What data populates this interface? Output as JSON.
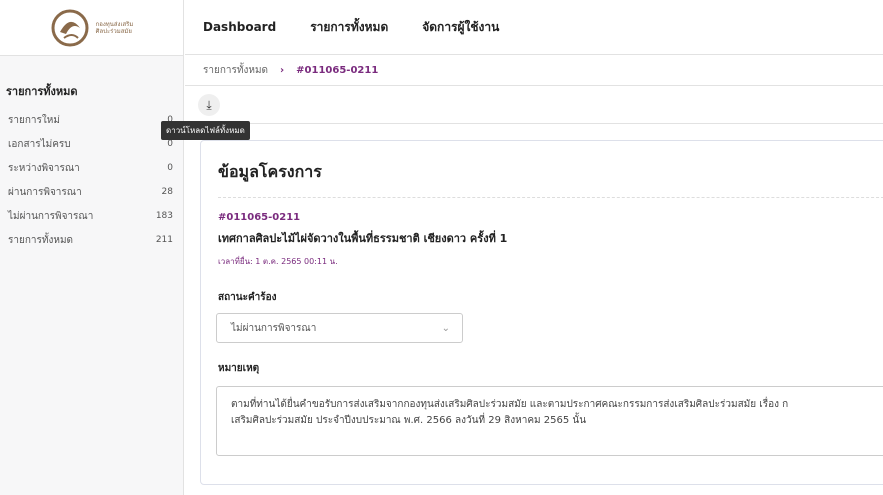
{
  "sidebar": {
    "logo_line1": "กองทุนส่งเสริม",
    "logo_line2": "ศิลปะร่วมสมัย",
    "title": "รายการทั้งหมด",
    "items": [
      {
        "label": "รายการใหม่",
        "count": "0"
      },
      {
        "label": "เอกสารไม่ครบ",
        "count": "0"
      },
      {
        "label": "ระหว่างพิจารณา",
        "count": "0"
      },
      {
        "label": "ผ่านการพิจารณา",
        "count": "28"
      },
      {
        "label": "ไม่ผ่านการพิจารณา",
        "count": "183"
      },
      {
        "label": "รายการทั้งหมด",
        "count": "211"
      }
    ]
  },
  "topnav": {
    "dashboard": "Dashboard",
    "all_items": "รายการทั้งหมด",
    "user_mgmt": "จัดการผู้ใช้งาน"
  },
  "breadcrumb": {
    "parent": "รายการทั้งหมด",
    "separator": "›",
    "current": "#011065-0211"
  },
  "toolbar": {
    "download_icon": "⤓",
    "tooltip": "ดาวน์โหลดไฟล์ทั้งหมด"
  },
  "card": {
    "title": "ข้อมูลโครงการ",
    "project_id": "#011065-0211",
    "project_name": "เทศกาลศิลปะไม้ไผ่จัดวางในพื้นที่ธรรมชาติ เชียงดาว ครั้งที่ 1",
    "submitted": "เวลาที่ยื่น: 1 ต.ค. 2565 00:11 น.",
    "status_label": "สถานะคำร้อง",
    "status_value": "ไม่ผ่านการพิจารณา",
    "notes_label": "หมายเหตุ",
    "notes_line1": "ตามที่ท่านได้ยื่นคำขอรับการส่งเสริมจากกองทุนส่งเสริมศิลปะร่วมสมัย และตามประกาศคณะกรรมการส่งเสริมศิลปะร่วมสมัย เรื่อง ก",
    "notes_line2": "เสริมศิลปะร่วมสมัย ประจำปีงบประมาณ พ.ศ. 2566 ลงวันที่ 29 สิงหาคม 2565 นั้น"
  },
  "colors": {
    "accent": "#7a2b7e",
    "logo": "#8a6a4a"
  }
}
